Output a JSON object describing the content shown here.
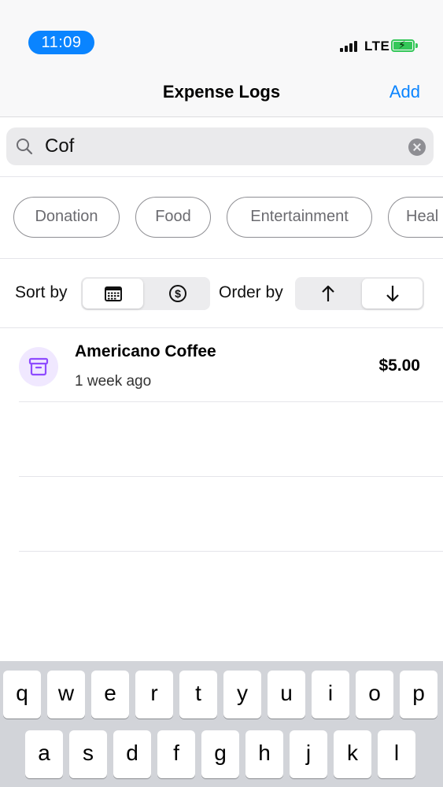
{
  "status_bar": {
    "time": "11:09",
    "network": "LTE",
    "battery_icon": "battery-charging-icon",
    "signal_icon": "signal-bars-icon"
  },
  "nav": {
    "title": "Expense Logs",
    "add_label": "Add"
  },
  "search": {
    "value": "Cof",
    "search_icon": "magnifier-icon",
    "clear_icon": "clear-circle-icon"
  },
  "categories": [
    "Donation",
    "Food",
    "Entertainment",
    "Heal"
  ],
  "sort": {
    "label": "Sort by",
    "options": [
      {
        "icon": "calendar-icon",
        "selected": true
      },
      {
        "icon": "dollar-circle-icon",
        "selected": false
      }
    ]
  },
  "order": {
    "label": "Order by",
    "options": [
      {
        "icon": "arrow-up-icon",
        "selected": false
      },
      {
        "icon": "arrow-down-icon",
        "selected": true
      }
    ]
  },
  "expenses": [
    {
      "title": "Americano Coffee",
      "time_ago": "1 week ago",
      "amount": "$5.00",
      "icon": "archive-box-icon",
      "accent": "#8e4bff"
    }
  ],
  "keyboard": {
    "row1": [
      "q",
      "w",
      "e",
      "r",
      "t",
      "y",
      "u",
      "i",
      "o",
      "p"
    ],
    "row2": [
      "a",
      "s",
      "d",
      "f",
      "g",
      "h",
      "j",
      "k",
      "l"
    ]
  },
  "colors": {
    "accent": "#0a84ff",
    "battery": "#34c759"
  }
}
